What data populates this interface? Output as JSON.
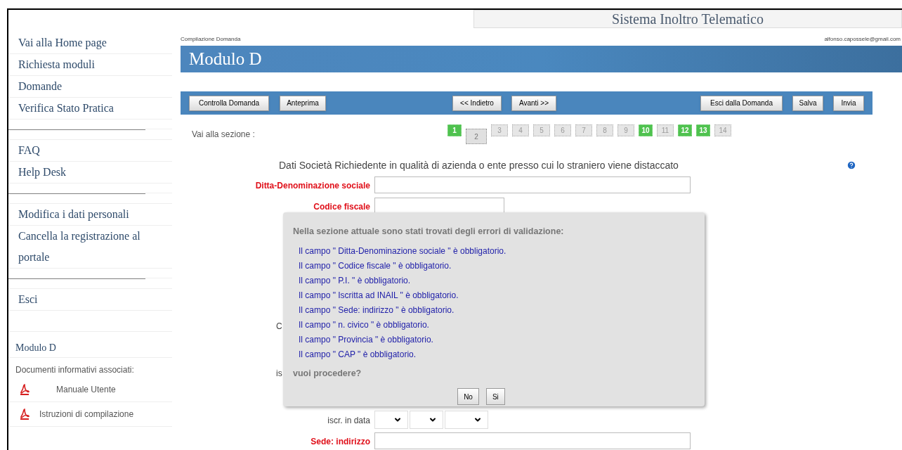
{
  "header": {
    "title": "Sistema Inoltro Telematico"
  },
  "sidebar": {
    "groups": [
      {
        "items": [
          "Vai alla Home page",
          "Richiesta moduli",
          "Domande",
          "Verifica Stato Pratica"
        ]
      },
      {
        "items": [
          "FAQ",
          "Help Desk"
        ]
      },
      {
        "items": [
          "Modifica i dati personali",
          "Cancella la registrazione al portale"
        ]
      },
      {
        "items": [
          "Esci"
        ]
      }
    ],
    "module": {
      "title": "Modulo D",
      "docs_label": "Documenti informativi associati:",
      "docs": [
        "Manuale Utente",
        "Istruzioni di compilazione"
      ]
    }
  },
  "breadcrumb": "Compilazione Domanda",
  "user_email": "alfonso.capossele@gmail.com",
  "page_title": "Modulo D",
  "toolbar": {
    "left": [
      "Controlla Domanda",
      "Anteprima"
    ],
    "middle": [
      "<< Indietro",
      "Avanti >>"
    ],
    "right": [
      "Esci dalla Domanda",
      "Salva",
      "Invia"
    ]
  },
  "sections": {
    "label": "Vai alla sezione :",
    "pages": [
      {
        "label": "1",
        "done": true,
        "selected": false
      },
      {
        "label": "2",
        "done": false,
        "selected": true
      },
      {
        "label": "3",
        "done": false,
        "selected": false
      },
      {
        "label": "4",
        "done": false,
        "selected": false
      },
      {
        "label": "5",
        "done": false,
        "selected": false
      },
      {
        "label": "6",
        "done": false,
        "selected": false
      },
      {
        "label": "7",
        "done": false,
        "selected": false
      },
      {
        "label": "8",
        "done": false,
        "selected": false
      },
      {
        "label": "9",
        "done": false,
        "selected": false
      },
      {
        "label": "10",
        "done": true,
        "selected": false
      },
      {
        "label": "11",
        "done": false,
        "selected": false
      },
      {
        "label": "12",
        "done": true,
        "selected": false
      },
      {
        "label": "13",
        "done": true,
        "selected": false
      },
      {
        "label": "14",
        "done": false,
        "selected": false
      }
    ]
  },
  "form": {
    "heading": "Dati Società Richiedente in qualità di azienda o ente presso cui lo straniero viene distaccato",
    "rows": [
      {
        "kind": "wide_text",
        "label": "Ditta-Denominazione sociale",
        "required": true
      },
      {
        "kind": "short_text",
        "label": "Codice fiscale",
        "required": true
      },
      {
        "kind": "hidden",
        "label": "C",
        "required": false
      },
      {
        "kind": "hidden",
        "label": "is",
        "required": false
      },
      {
        "kind": "date",
        "label": "iscr. in data",
        "required": false
      },
      {
        "kind": "wide_text",
        "label": "Sede: indirizzo",
        "required": true
      }
    ]
  },
  "dialog": {
    "title": "Nella sezione attuale sono stati trovati degli errori di validazione:",
    "errors": [
      "Il campo \" Ditta-Denominazione sociale \" è obbligatorio.",
      "Il campo \" Codice fiscale \" è obbligatorio.",
      "Il campo \" P.I. \" è obbligatorio.",
      "Il campo \" Iscritta ad INAIL \" è obbligatorio.",
      "Il campo \" Sede: indirizzo \" è obbligatorio.",
      "Il campo \" n. civico \" è obbligatorio.",
      "Il campo \" Provincia \" è obbligatorio.",
      "Il campo \" CAP \" è obbligatorio."
    ],
    "question": "vuoi procedere?",
    "buttons": [
      "No",
      "Si"
    ]
  }
}
